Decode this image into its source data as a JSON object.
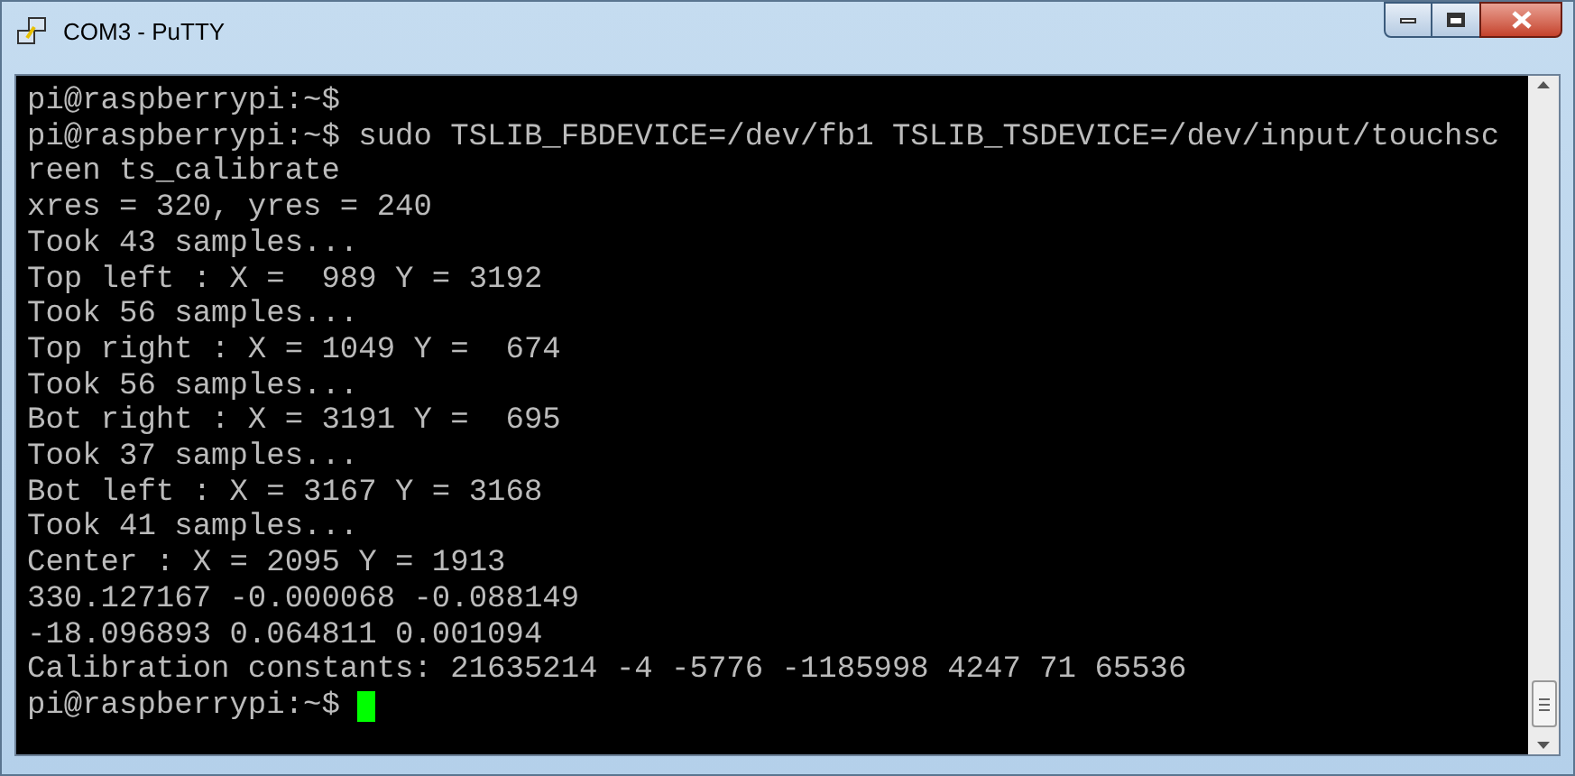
{
  "window": {
    "title": "COM3 - PuTTY"
  },
  "terminal": {
    "lines": [
      "pi@raspberrypi:~$",
      "pi@raspberrypi:~$ sudo TSLIB_FBDEVICE=/dev/fb1 TSLIB_TSDEVICE=/dev/input/touchsc",
      "reen ts_calibrate",
      "xres = 320, yres = 240",
      "Took 43 samples...",
      "Top left : X =  989 Y = 3192",
      "Took 56 samples...",
      "Top right : X = 1049 Y =  674",
      "Took 56 samples...",
      "Bot right : X = 3191 Y =  695",
      "Took 37 samples...",
      "Bot left : X = 3167 Y = 3168",
      "Took 41 samples...",
      "Center : X = 2095 Y = 1913",
      "330.127167 -0.000068 -0.088149",
      "-18.096893 0.064811 0.001094",
      "Calibration constants: 21635214 -4 -5776 -1185998 4247 71 65536"
    ],
    "prompt": "pi@raspberrypi:~$"
  }
}
